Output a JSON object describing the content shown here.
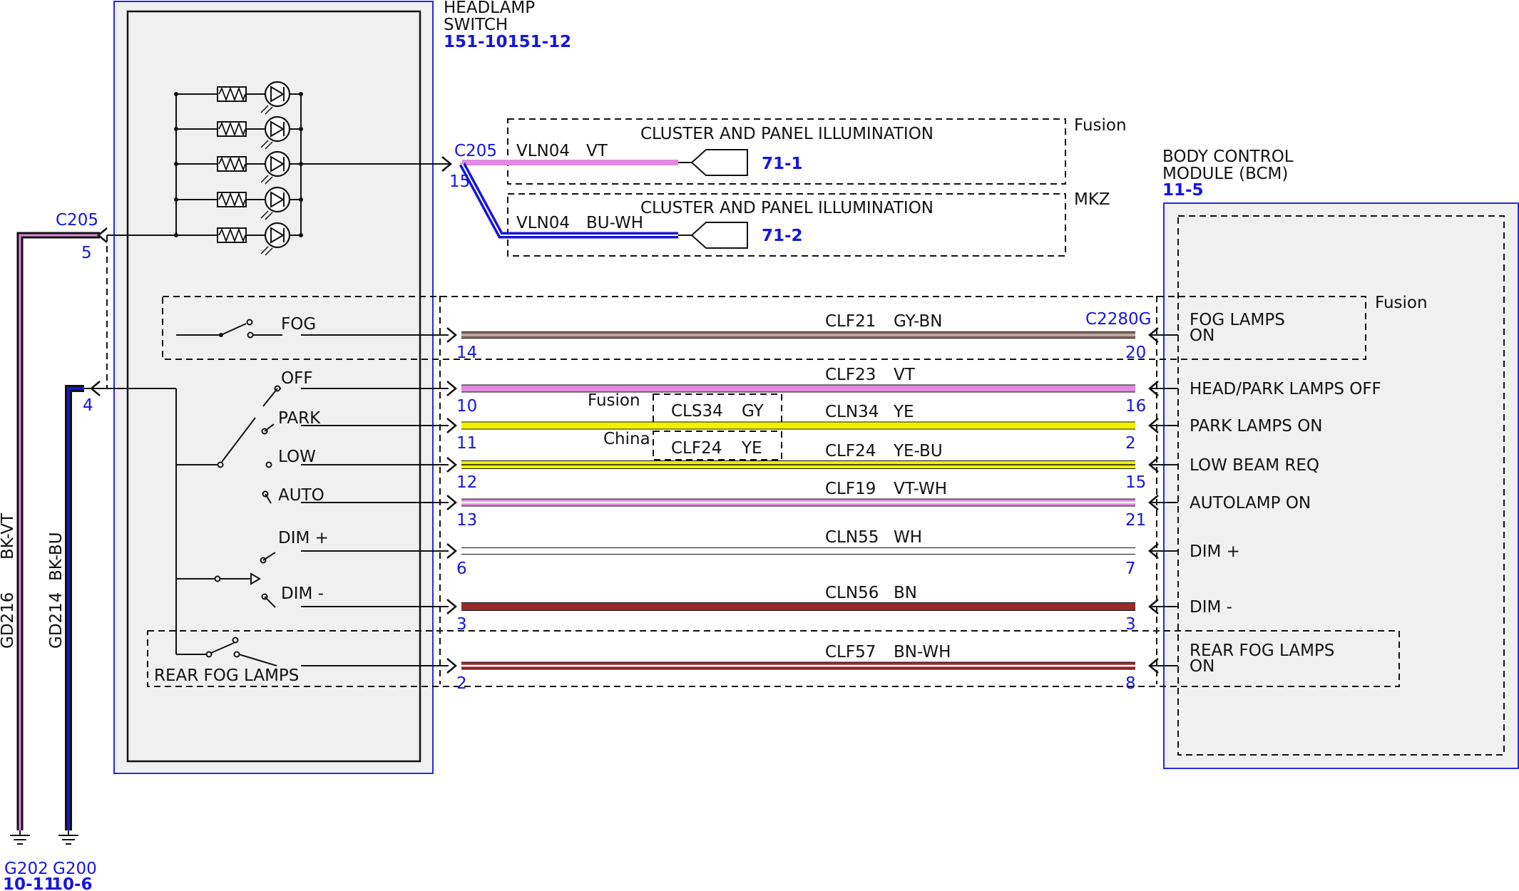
{
  "switch": {
    "title_line1": "HEADLAMP",
    "title_line2": "SWITCH",
    "ref": "151-10151-12",
    "labels": {
      "fog": "FOG",
      "off": "OFF",
      "park": "PARK",
      "low": "LOW",
      "auto": "AUTO",
      "dim_plus": "DIM +",
      "dim_minus": "DIM -",
      "rear_fog": "REAR FOG LAMPS"
    }
  },
  "bcm": {
    "title_line1": "BODY CONTROL",
    "title_line2": "MODULE (BCM)",
    "ref": "11-5",
    "connector": "C2280G",
    "variant": "Fusion"
  },
  "illumination": {
    "connector": "C205",
    "pin": "15",
    "fusion": {
      "variant": "Fusion",
      "title": "CLUSTER AND PANEL ILLUMINATION",
      "circuit": "VLN04",
      "color": "VT",
      "ref": "71-1"
    },
    "mkz": {
      "variant": "MKZ",
      "title": "CLUSTER AND PANEL ILLUMINATION",
      "circuit": "VLN04",
      "color": "BU-WH",
      "ref": "71-2"
    }
  },
  "grounds": {
    "connector": "C205",
    "g216": {
      "circuit": "GD216",
      "color": "BK-VT",
      "pin": "5",
      "ground": "G202",
      "ref": "10-11"
    },
    "g214": {
      "circuit": "GD214",
      "color": "BK-BU",
      "pin": "4",
      "ground": "G200",
      "ref": "10-6"
    }
  },
  "wires": [
    {
      "circuit": "CLF21",
      "color": "GY-BN",
      "left_pin": "14",
      "right_pin": "20",
      "bcm_label1": "FOG LAMPS",
      "bcm_label2": "ON"
    },
    {
      "circuit": "CLF23",
      "color": "VT",
      "left_pin": "10",
      "right_pin": "16",
      "bcm_label1": "HEAD/PARK LAMPS OFF",
      "bcm_label2": ""
    },
    {
      "circuit": "CLN34",
      "color": "YE",
      "left_pin": "11",
      "right_pin": "2",
      "bcm_label1": "PARK LAMPS ON",
      "bcm_label2": ""
    },
    {
      "circuit": "CLF24",
      "color": "YE-BU",
      "left_pin": "12",
      "right_pin": "15",
      "bcm_label1": "LOW BEAM REQ",
      "bcm_label2": ""
    },
    {
      "circuit": "CLF19",
      "color": "VT-WH",
      "left_pin": "13",
      "right_pin": "21",
      "bcm_label1": "AUTOLAMP ON",
      "bcm_label2": ""
    },
    {
      "circuit": "CLN55",
      "color": "WH",
      "left_pin": "6",
      "right_pin": "7",
      "bcm_label1": "DIM +",
      "bcm_label2": ""
    },
    {
      "circuit": "CLN56",
      "color": "BN",
      "left_pin": "3",
      "right_pin": "3",
      "bcm_label1": "DIM -",
      "bcm_label2": ""
    },
    {
      "circuit": "CLF57",
      "color": "BN-WH",
      "left_pin": "2",
      "right_pin": "8",
      "bcm_label1": "REAR FOG LAMPS",
      "bcm_label2": "ON"
    }
  ],
  "variants": {
    "fusion_label": "Fusion",
    "fusion_circuit": "CLS34",
    "fusion_color": "GY",
    "china_label": "China",
    "china_circuit": "CLF24",
    "china_color": "YE"
  },
  "wire_colors": {
    "violet": "#e08ae0",
    "yellow": "#f2f200",
    "brown": "#9b2b2b",
    "gray_brown": "#8c6f6a",
    "blue": "#1515d8",
    "black": "#111111",
    "ref_blue": "#1515e0"
  }
}
